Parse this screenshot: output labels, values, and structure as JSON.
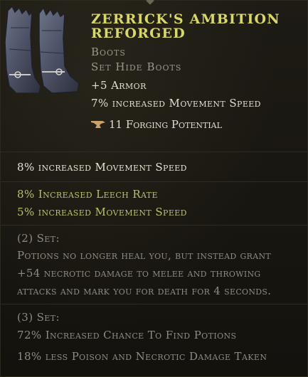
{
  "item": {
    "name_line1": "Zerrick's Ambition",
    "name_line2": "Reforged",
    "type": "Boots",
    "subtype": "Set Hide Boots",
    "implicits": [
      "+5 Armor",
      "7% increased Movement Speed"
    ],
    "forging": "11 Forging Potential",
    "forging_icon": "anvil-icon",
    "art_icon": "leather-boots-icon"
  },
  "affixes": [
    "8% increased Movement Speed"
  ],
  "set_bonuses": [
    "8% Increased Leech Rate",
    "5% increased Movement Speed"
  ],
  "set2": {
    "label": "(2) Set:",
    "lines": [
      "Potions no longer heal you, but instead grant",
      "+54 necrotic damage to melee and throwing",
      "attacks and mark you for death for 4 seconds."
    ]
  },
  "set3": {
    "label": "(3) Set:",
    "lines": [
      "72% Increased Chance To Find Potions",
      "18% less Poison and Necrotic Damage Taken"
    ]
  },
  "colors": {
    "title": "#d8d76a",
    "set_green": "#b6c36a",
    "muted": "#8e8b83",
    "background": "#17150f"
  }
}
